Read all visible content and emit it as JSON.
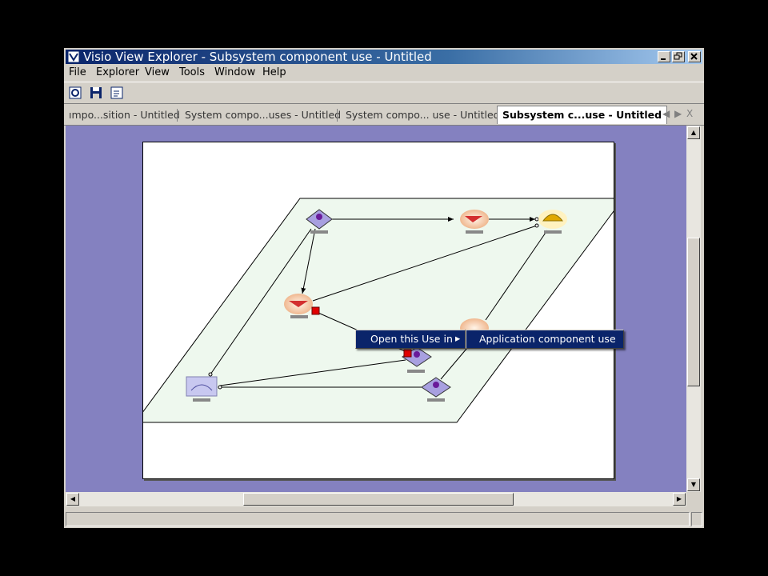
{
  "window": {
    "title": "Visio View Explorer - Subsystem component use - Untitled",
    "caption_buttons": [
      "minimize",
      "restore",
      "close"
    ]
  },
  "menubar": {
    "items": [
      "File",
      "Explorer",
      "View",
      "Tools",
      "Window",
      "Help"
    ]
  },
  "toolbar": {
    "buttons": [
      "explorer-icon",
      "save-icon",
      "refresh-icon"
    ]
  },
  "tabs": {
    "items": [
      {
        "label": "ımpo...sition - Untitled",
        "active": false
      },
      {
        "label": "System compo...uses - Untitled",
        "active": false
      },
      {
        "label": "System compo... use - Untitled",
        "active": false
      },
      {
        "label": "Subsystem c...use - Untitled",
        "active": true
      }
    ],
    "controls": [
      "◀",
      "▶",
      "X"
    ]
  },
  "context_menu": {
    "item": "Open this Use in",
    "arrow": "▸",
    "submenu_item": "Application component use"
  },
  "colors": {
    "canvas_bg": "#8481c0",
    "page_bg": "#ffffff",
    "diagram_plane": "#eef8ee",
    "menu_highlight": "#0a246a",
    "title_gradient_start": "#0a246a",
    "selection_handle": "#e00000"
  },
  "diagram": {
    "nodes": [
      {
        "id": "n1",
        "icon": "component-diamond-icon"
      },
      {
        "id": "n2",
        "icon": "use-ellipse-icon"
      },
      {
        "id": "n3",
        "icon": "hardhat-component-icon"
      },
      {
        "id": "n4",
        "icon": "use-ellipse-icon"
      },
      {
        "id": "n5",
        "icon": "use-ellipse-icon"
      },
      {
        "id": "n6",
        "icon": "component-diamond-icon"
      },
      {
        "id": "n7",
        "icon": "subsystem-image-icon"
      },
      {
        "id": "n8",
        "icon": "component-diamond-icon"
      }
    ]
  }
}
